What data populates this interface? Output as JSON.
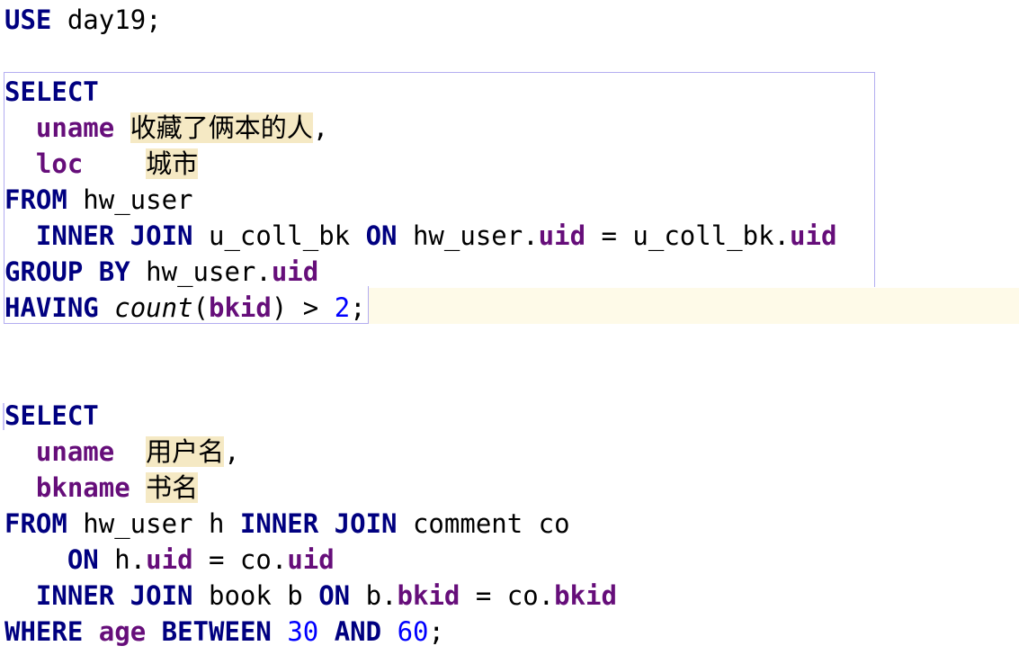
{
  "editor": {
    "line1": {
      "kw_use": "USE",
      "db": " day19;"
    },
    "query1": {
      "select": "SELECT",
      "uname": "uname",
      "uname_alias": "收藏了俩本的人",
      "comma1": ",",
      "loc": "loc",
      "loc_alias": "城市",
      "from": "FROM",
      "table1": " hw_user",
      "inner_join": "INNER JOIN",
      "table2": " u_coll_bk ",
      "on": "ON",
      "cond_left": " hw_user.",
      "uid1": "uid",
      "eq": " = u_coll_bk.",
      "uid2": "uid",
      "group_by": "GROUP BY",
      "group_tbl": " hw_user.",
      "uid3": "uid",
      "having": "HAVING",
      "count_fn": "count",
      "paren_open": "(",
      "bkid": "bkid",
      "paren_close": ") > ",
      "num2": "2",
      "semi": ";"
    },
    "query2": {
      "select": "SELECT",
      "uname": "uname",
      "uname_alias": "用户名",
      "comma1": ",",
      "bkname": "bkname",
      "bkname_alias": "书名",
      "from": "FROM",
      "table1": " hw_user h ",
      "inner_join1": "INNER JOIN",
      "table2": " comment co",
      "on1": "ON",
      "cond1_left": " h.",
      "uid1": "uid",
      "cond1_mid": " = co.",
      "uid2": "uid",
      "inner_join2": "INNER JOIN",
      "table3": " book b ",
      "on2": "ON",
      "cond2_left": " b.",
      "bkid1": "bkid",
      "cond2_mid": " = co.",
      "bkid2": "bkid",
      "where": "WHERE",
      "age": "age",
      "between": "BETWEEN",
      "num30": "30",
      "and": "AND",
      "num60": "60",
      "semi": ";"
    }
  }
}
